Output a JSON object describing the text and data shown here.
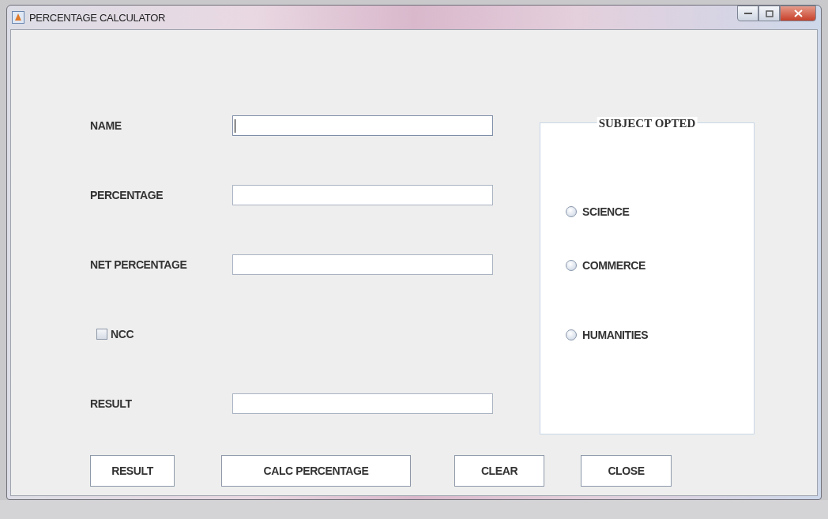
{
  "window": {
    "title": "PERCENTAGE CALCULATOR"
  },
  "fields": [
    {
      "label": "NAME",
      "focused": true
    },
    {
      "label": "PERCENTAGE",
      "focused": false
    },
    {
      "label": "NET PERCENTAGE",
      "focused": false
    },
    {
      "kind": "checkbox",
      "label": "NCC",
      "checked": false
    },
    {
      "label": "RESULT",
      "focused": false
    }
  ],
  "subject_group": {
    "title": "SUBJECT OPTED",
    "options": [
      {
        "label": "SCIENCE",
        "selected": false
      },
      {
        "label": "COMMERCE",
        "selected": false
      },
      {
        "label": "HUMANITIES",
        "selected": false
      }
    ]
  },
  "buttons": [
    "RESULT",
    "CALC PERCENTAGE",
    "CLEAR",
    "CLOSE"
  ]
}
